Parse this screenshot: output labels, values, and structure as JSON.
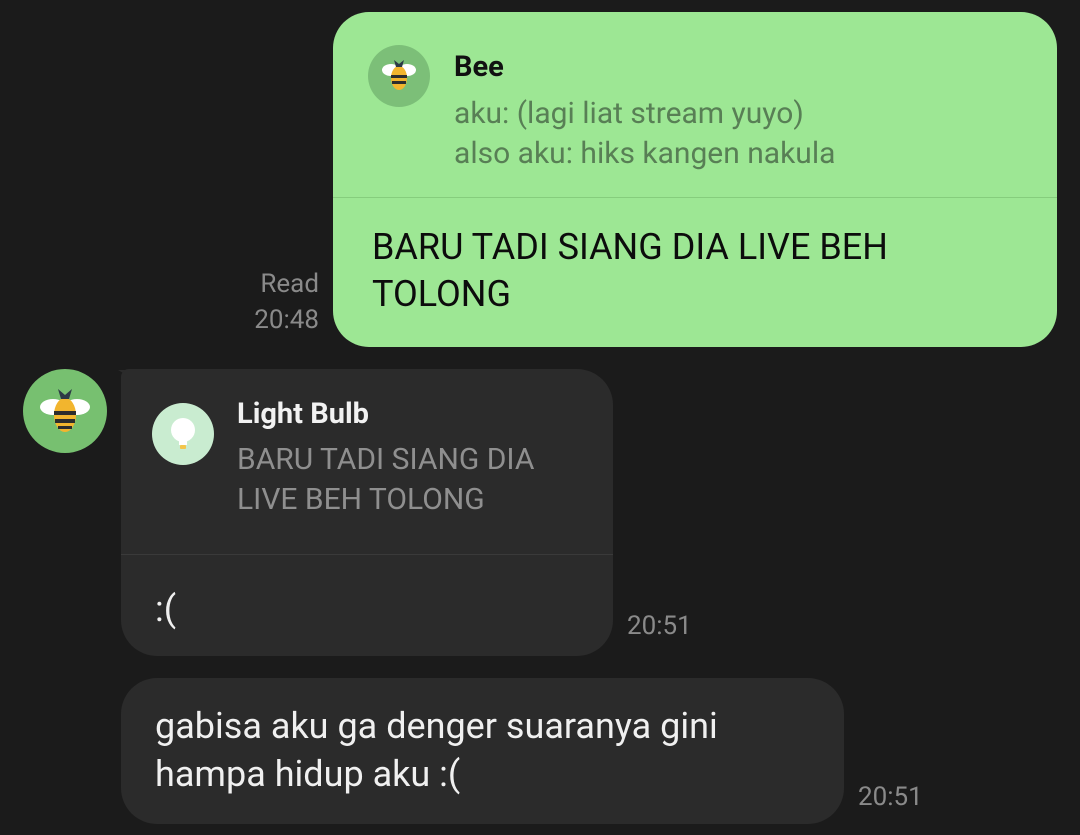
{
  "outgoing_message": {
    "quote": {
      "name": "Bee",
      "text": "aku: (lagi liat stream yuyo)\nalso aku: hiks kangen nakula",
      "avatar_icon": "bee-icon"
    },
    "text": "BARU TADI SIANG DIA LIVE BEH TOLONG",
    "status": "Read",
    "time": "20:48"
  },
  "incoming_messages": [
    {
      "quote": {
        "name": "Light Bulb",
        "text": "BARU TADI SIANG DIA LIVE BEH TOLONG",
        "avatar_icon": "light-bulb-icon"
      },
      "text": ":(",
      "time": "20:51"
    },
    {
      "text": "gabisa aku ga denger suaranya gini hampa hidup aku :(",
      "time": "20:51"
    }
  ],
  "sender": {
    "avatar_icon": "bee-icon"
  },
  "colors": {
    "background": "#1b1b1b",
    "outgoing_bubble": "#9de794",
    "incoming_bubble": "#2b2b2b",
    "timestamp": "#8a8a8a"
  }
}
